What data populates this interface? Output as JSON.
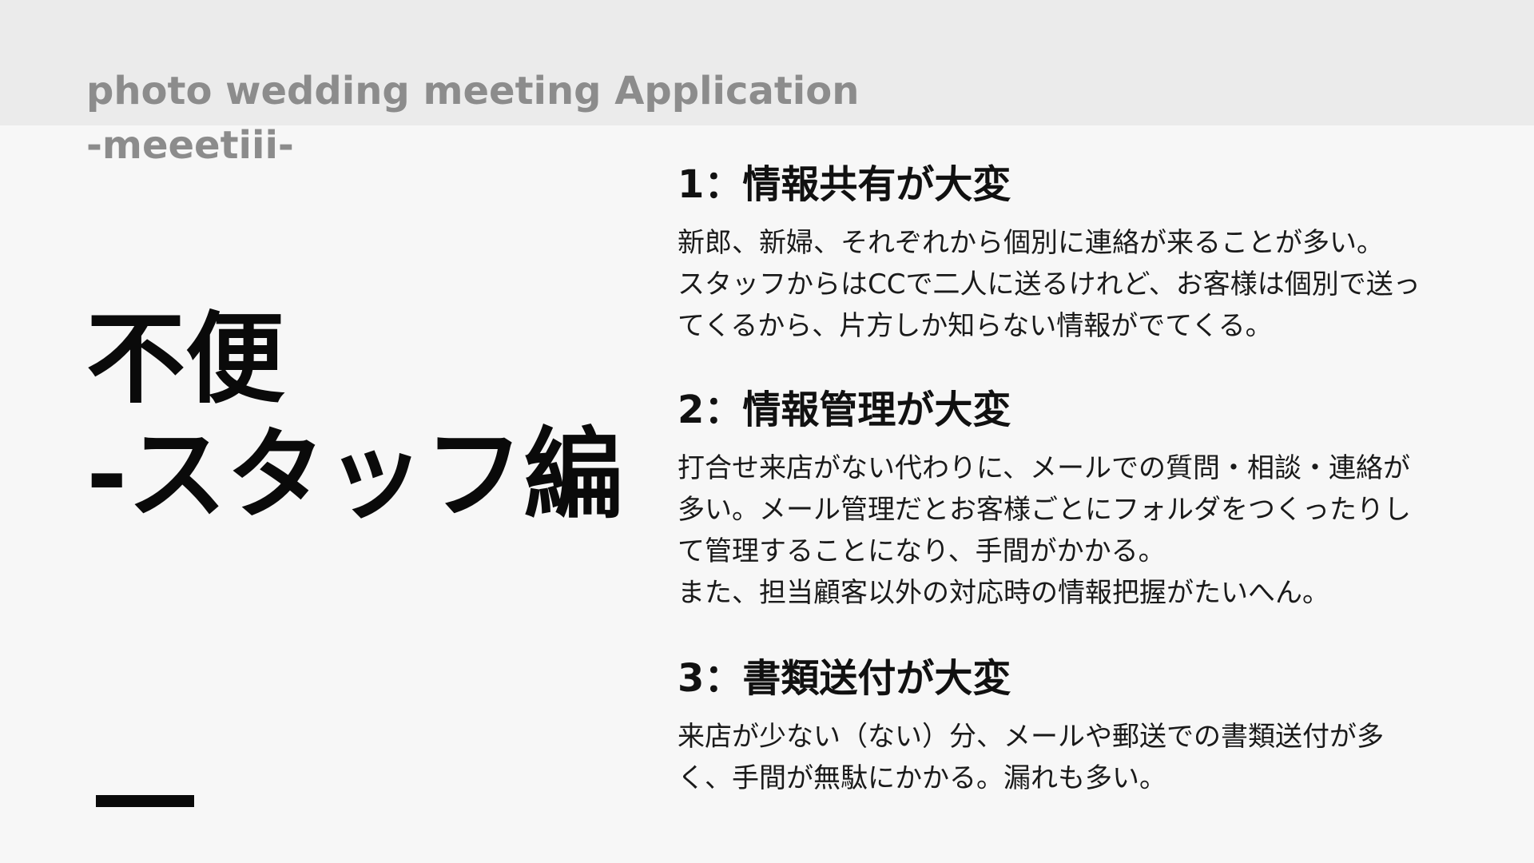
{
  "header": {
    "app_title_line1": "photo wedding meeting Application",
    "app_title_line2": "-meeetiii-",
    "band_color": "#ebebeb",
    "title_color": "#8c8c8c"
  },
  "main_heading": {
    "line1": "不便",
    "line2": "-スタッフ編"
  },
  "sections": [
    {
      "title": "1：情報共有が大変",
      "body_lines": [
        "新郎、新婦、それぞれから個別に連絡が来ることが多い。",
        "スタッフからはCCで二人に送るけれど、お客様は個別で送っ",
        "てくるから、片方しか知らない情報がでてくる。"
      ]
    },
    {
      "title": "2：情報管理が大変",
      "body_lines": [
        "打合せ来店がない代わりに、メールでの質問・相談・連絡が",
        "多い。メール管理だとお客様ごとにフォルダをつくったりし",
        "て管理することになり、手間がかかる。",
        "また、担当顧客以外の対応時の情報把握がたいへん。"
      ]
    },
    {
      "title": "3：書類送付が大変",
      "body_lines": [
        "来店が少ない（ない）分、メールや郵送での書類送付が多",
        "く、手間が無駄にかかる。漏れも多い。"
      ]
    }
  ]
}
